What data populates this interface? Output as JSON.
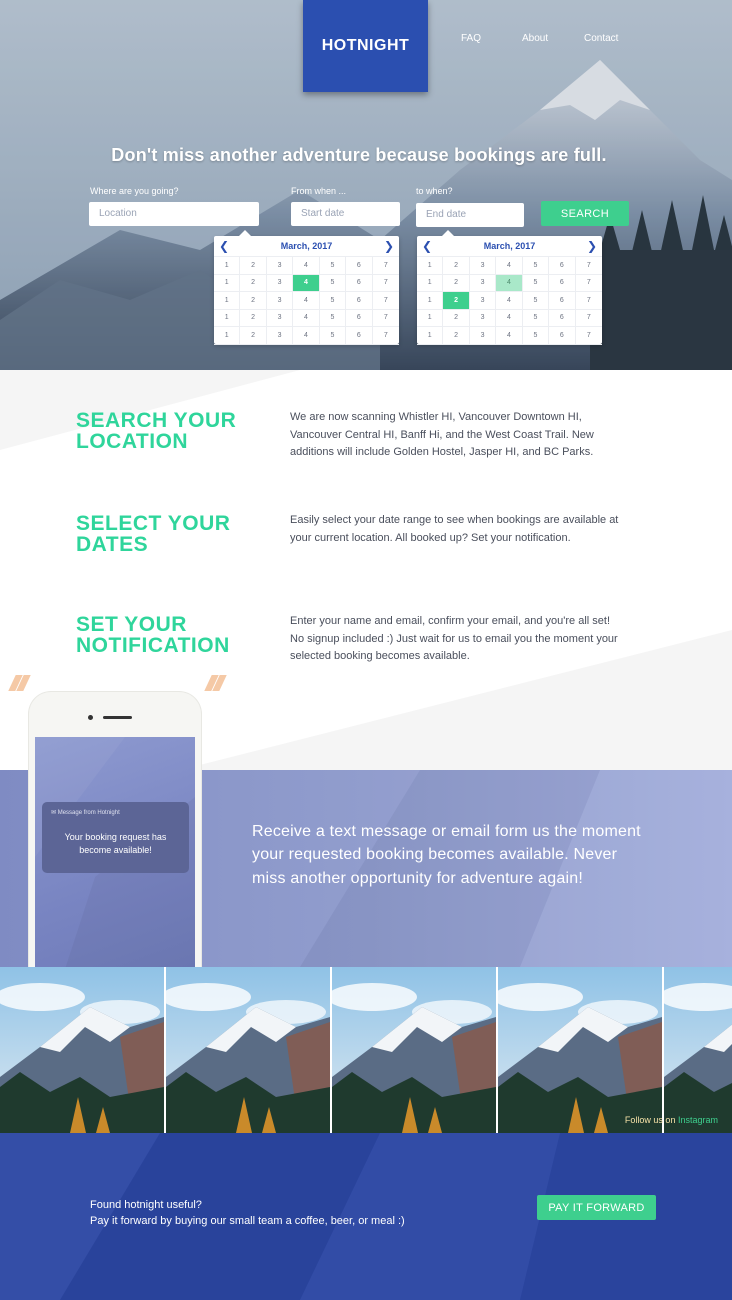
{
  "brand": "HOTNIGHT",
  "nav": [
    "FAQ",
    "About",
    "Contact"
  ],
  "hero": {
    "title": "Don't miss another adventure because bookings are full.",
    "location_label": "Where are you going?",
    "location_placeholder": "Location",
    "start_label": "From when ...",
    "start_placeholder": "Start date",
    "end_label": "to when?",
    "end_placeholder": "End date",
    "search_label": "SEARCH"
  },
  "calendars": [
    {
      "month": "March, 2017",
      "selected_day": "4",
      "selected_row": 1,
      "rows": [
        [
          "1",
          "2",
          "3",
          "4",
          "5",
          "6",
          "7"
        ],
        [
          "1",
          "2",
          "3",
          "4",
          "5",
          "6",
          "7"
        ],
        [
          "1",
          "2",
          "3",
          "4",
          "5",
          "6",
          "7"
        ],
        [
          "1",
          "2",
          "3",
          "4",
          "5",
          "6",
          "7"
        ],
        [
          "1",
          "2",
          "3",
          "4",
          "5",
          "6",
          "7"
        ]
      ]
    },
    {
      "month": "March, 2017",
      "selected_day": "2",
      "selected_row": 2,
      "highlight_day": "4",
      "highlight_row": 1,
      "rows": [
        [
          "1",
          "2",
          "3",
          "4",
          "5",
          "6",
          "7"
        ],
        [
          "1",
          "2",
          "3",
          "4",
          "5",
          "6",
          "7"
        ],
        [
          "1",
          "2",
          "3",
          "4",
          "5",
          "6",
          "7"
        ],
        [
          "1",
          "2",
          "3",
          "4",
          "5",
          "6",
          "7"
        ],
        [
          "1",
          "2",
          "3",
          "4",
          "5",
          "6",
          "7"
        ]
      ]
    }
  ],
  "steps": [
    {
      "title_line1": "SEARCH YOUR",
      "title_line2": "LOCATION",
      "text": "We are now scanning Whistler HI, Vancouver Downtown HI, Vancouver Central HI, Banff Hi, and the West Coast Trail. New additions will include Golden Hostel, Jasper HI, and BC Parks."
    },
    {
      "title_line1": "SELECT YOUR",
      "title_line2": "DATES",
      "text": "Easily select your date range to see when bookings are available at your current location. All booked up? Set your notification."
    },
    {
      "title_line1": "SET YOUR",
      "title_line2": "NOTIFICATION",
      "text": "Enter your name and email, confirm your email, and you're all set! No signup included :) Just wait for us to email you the moment your selected booking becomes available."
    }
  ],
  "phone": {
    "notification_header": "Message from Hotnight",
    "notification_body_line1": "Your booking request has",
    "notification_body_line2": "become available!"
  },
  "notify_text": "Receive a text message or email form us the moment your requested booking becomes available. Never miss another opportunity for adventure again!",
  "gallery": {
    "follow_prefix": "Follow us on",
    "follow_link": "Instagram"
  },
  "footer": {
    "line1": "Found hotnight useful?",
    "line2": "Pay it forward by buying our small team a coffee, beer, or meal :)",
    "button_label": "PAY IT FORWARD"
  },
  "colors": {
    "brand_blue": "#2b4fb0",
    "accent_green": "#3ecf8e",
    "heading_green": "#2fd59b",
    "footer_blue": "#2c47a4"
  }
}
